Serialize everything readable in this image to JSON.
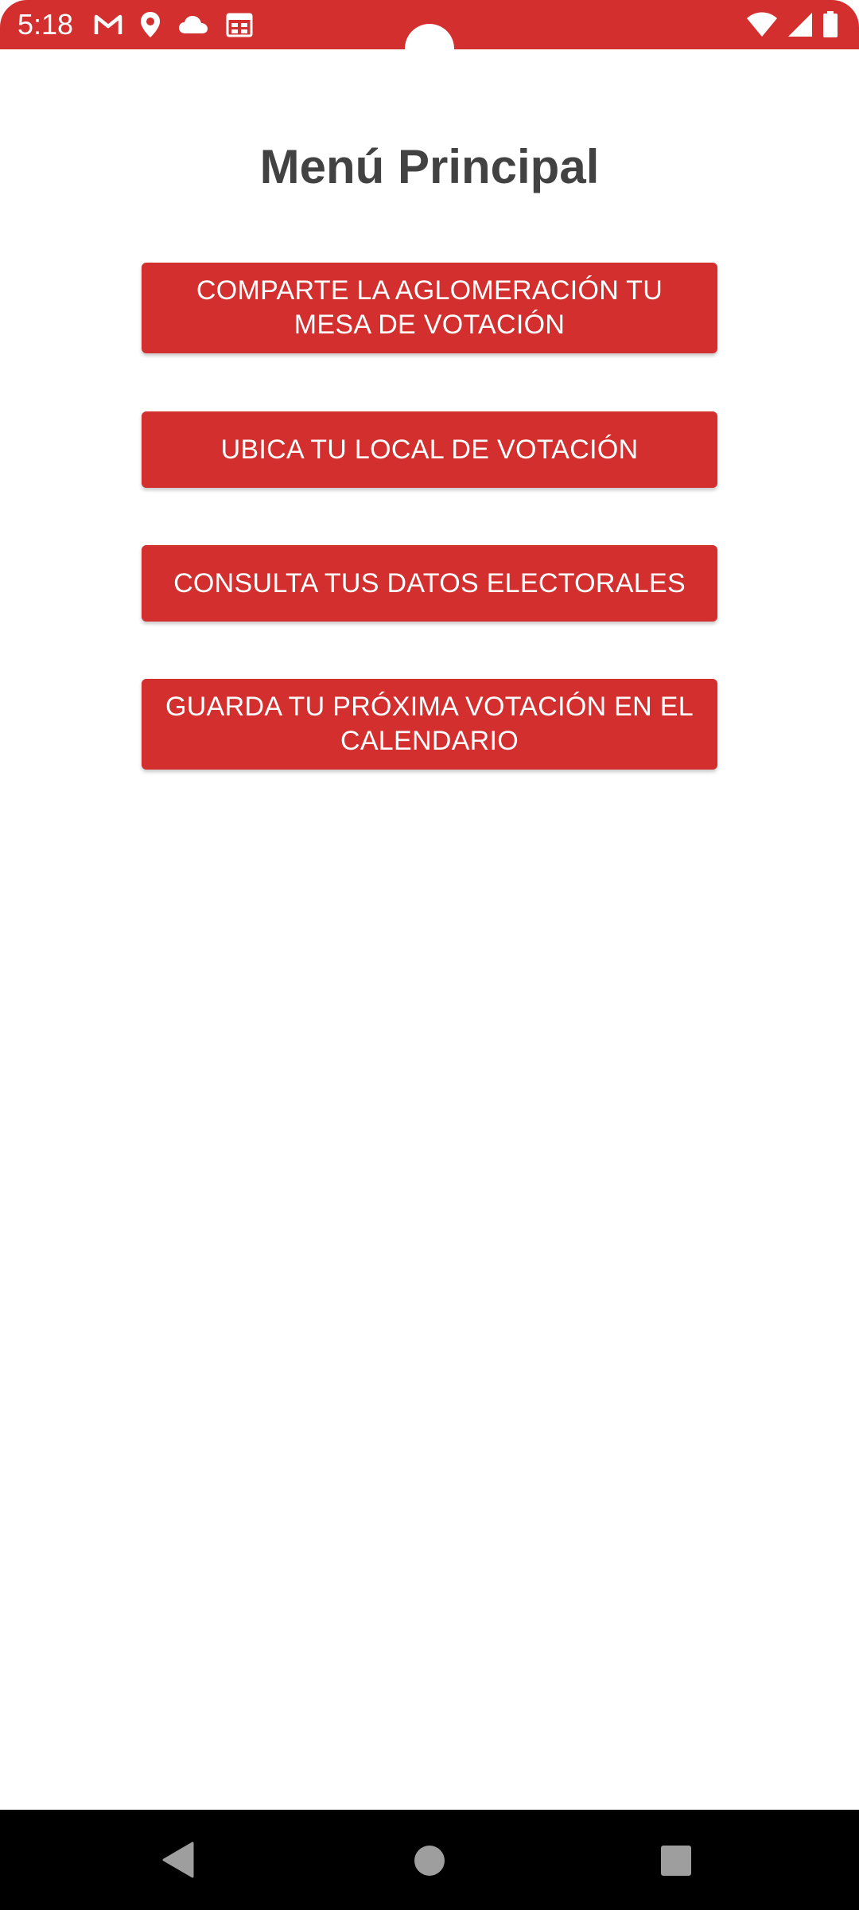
{
  "status_bar": {
    "time": "5:18",
    "left_icons": [
      "gmail-icon",
      "location-icon",
      "cloud-icon",
      "calendar-icon"
    ],
    "right_icons": [
      "wifi-icon",
      "signal-icon",
      "battery-icon"
    ],
    "background_color": "#d32f2f"
  },
  "page": {
    "title": "Menú Principal"
  },
  "menu": {
    "buttons": [
      {
        "label": "COMPARTE LA AGLOMERACIÓN TU MESA DE VOTACIÓN"
      },
      {
        "label": "UBICA TU LOCAL DE VOTACIÓN"
      },
      {
        "label": "CONSULTA TUS DATOS ELECTORALES"
      },
      {
        "label": "GUARDA TU PRÓXIMA VOTACIÓN EN EL CALENDARIO"
      }
    ],
    "button_color": "#d32f2f",
    "text_color": "#ffffff"
  },
  "nav_bar": {
    "icons": [
      "back-icon",
      "home-icon",
      "recents-icon"
    ]
  }
}
